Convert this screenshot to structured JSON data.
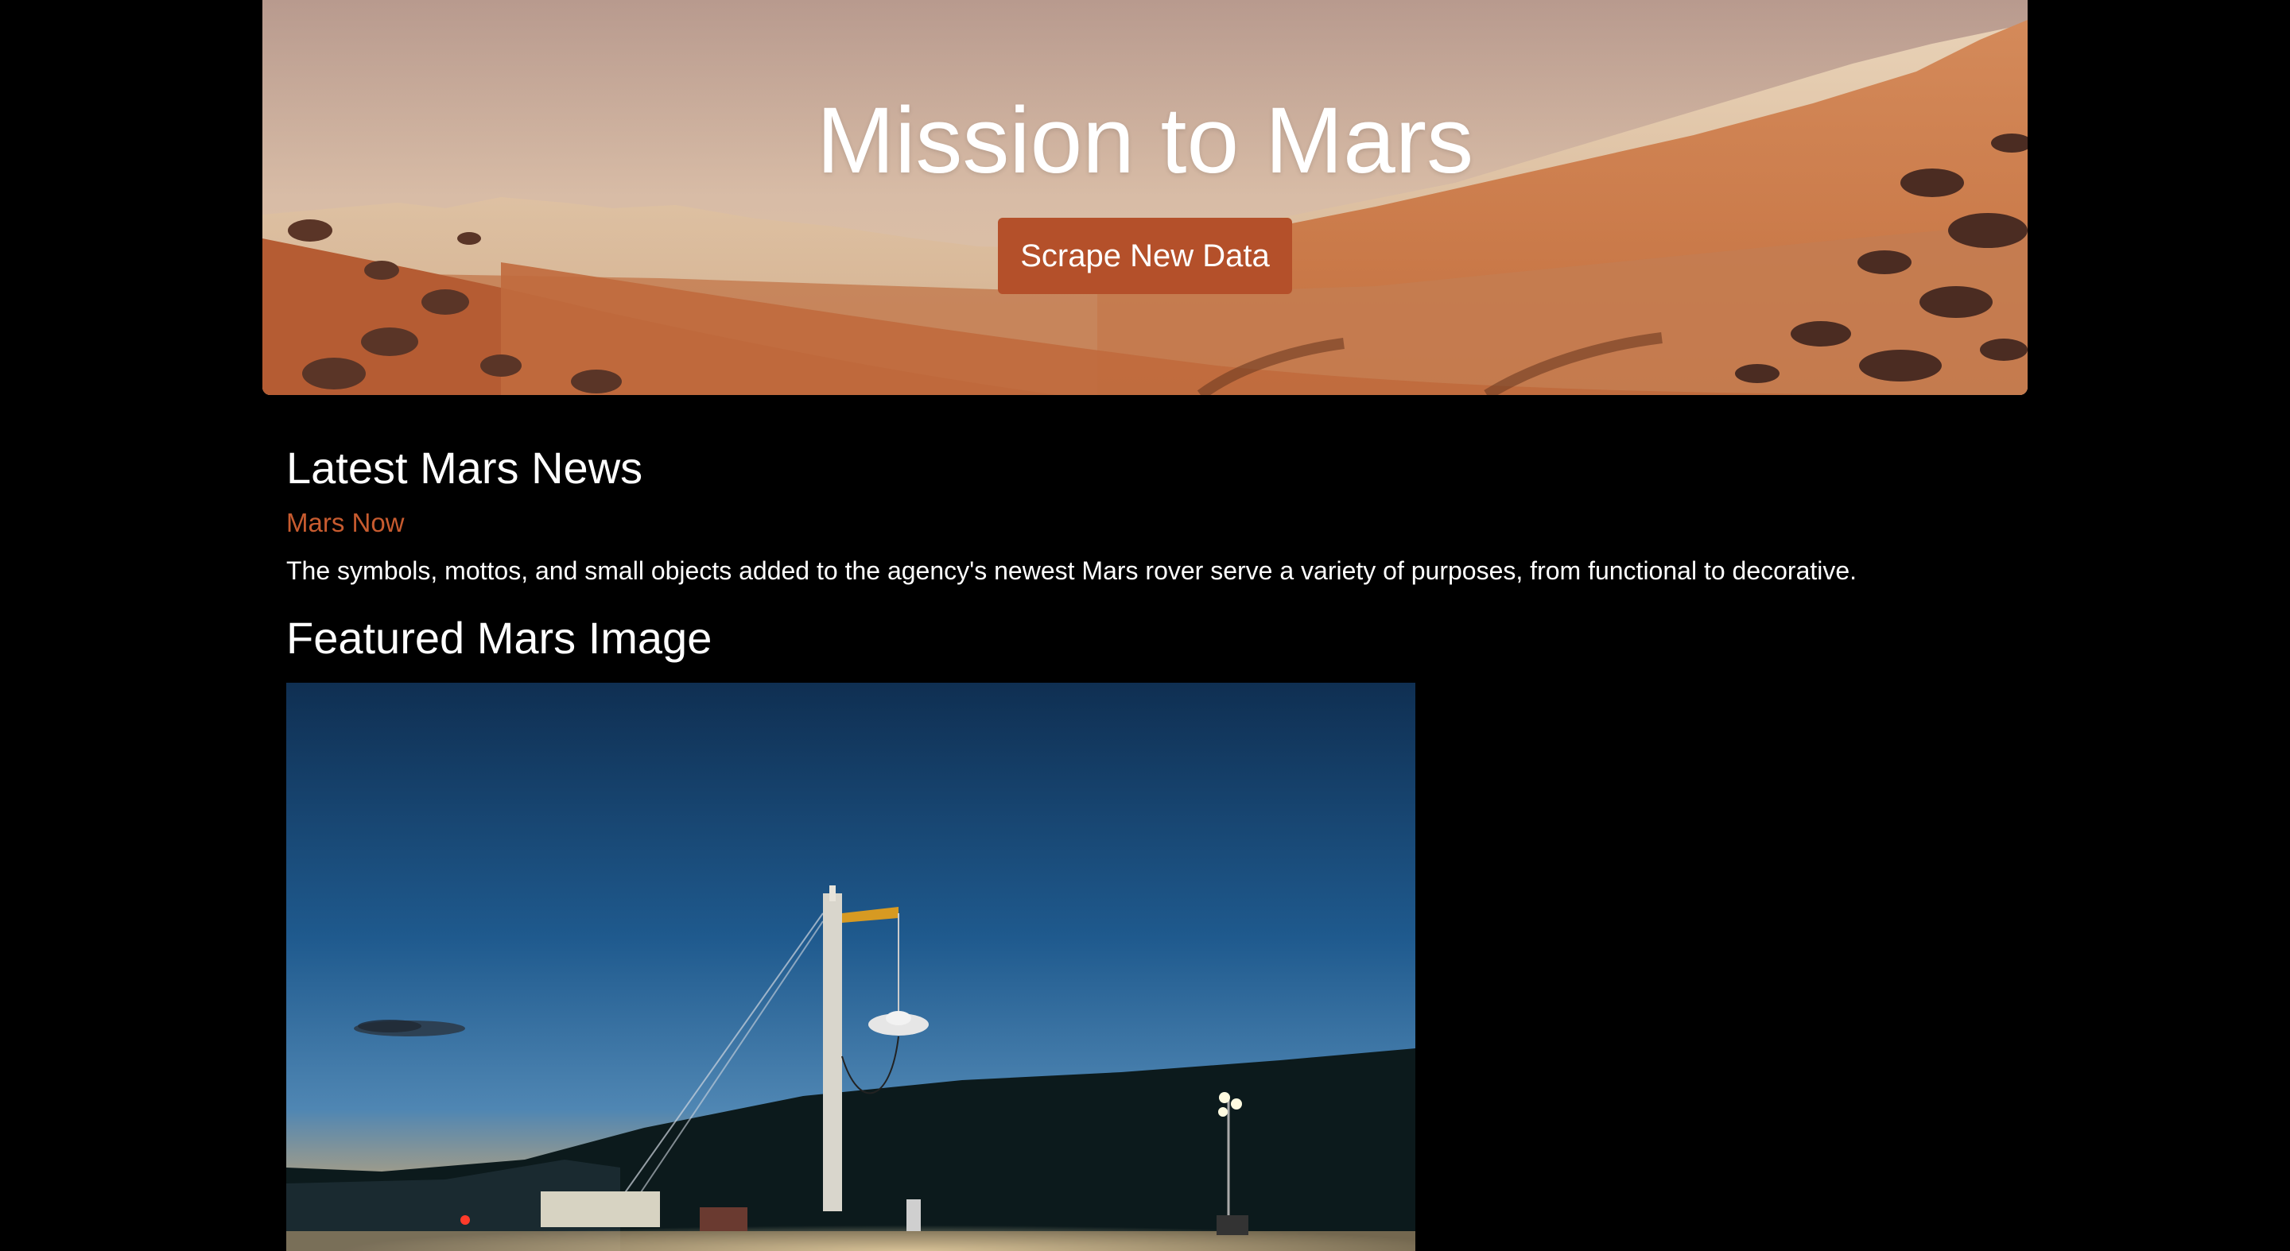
{
  "hero": {
    "title": "Mission to Mars",
    "button_label": "Scrape New Data"
  },
  "news": {
    "section_title": "Latest Mars News",
    "headline": "Mars Now",
    "paragraph": "The symbols, mottos, and small objects added to the agency's newest Mars rover serve a variety of purposes, from functional to decorative."
  },
  "featured": {
    "section_title": "Featured Mars Image"
  },
  "colors": {
    "accent": "#b4502a",
    "link": "#c75b2f",
    "background": "#000000"
  }
}
